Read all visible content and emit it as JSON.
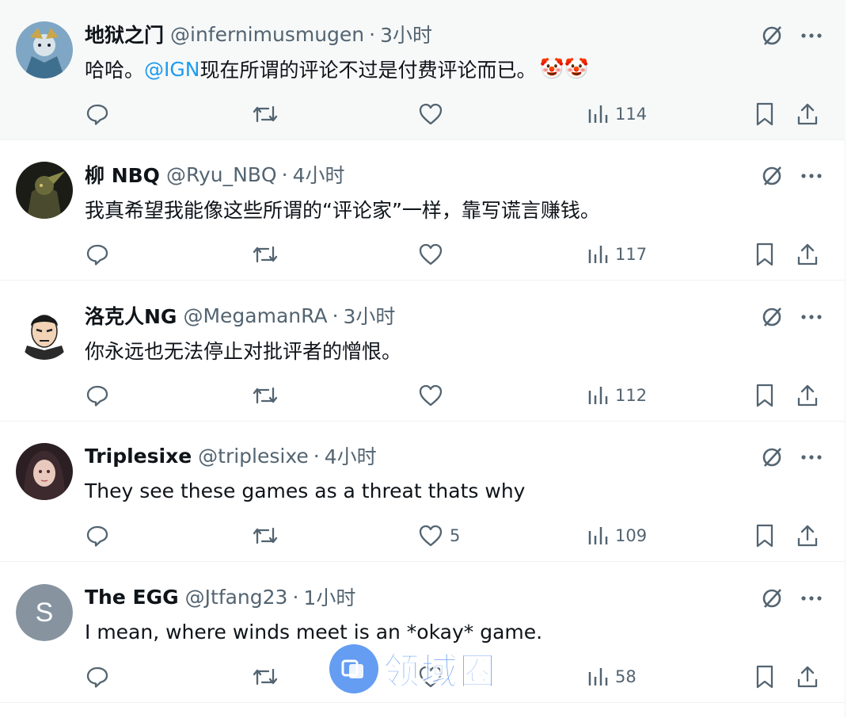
{
  "colors": {
    "link": "#1d9bf0",
    "secondary_text": "#536471",
    "primary_text": "#0f1419",
    "highlight_bg": "#f7f9f9",
    "watermark": "#4a8cf0"
  },
  "tweets": [
    {
      "name": "地狱之门",
      "handle": "@infernimusmugen",
      "sep": "·",
      "time": "3小时",
      "text_before": "哈哈。",
      "mention": "@IGN",
      "text_after": "现在所谓的评论不过是付费评论而已。",
      "emoji": "🤡🤡",
      "likes": "",
      "views": "114",
      "avatar": "anime-character-avatar"
    },
    {
      "name": "柳 NBQ",
      "handle": "@Ryu_NBQ",
      "sep": "·",
      "time": "4小时",
      "text": "我真希望我能像这些所谓的“评论家”一样，靠写谎言赚钱。",
      "likes": "",
      "views": "117",
      "avatar": "dark-armored-character-avatar"
    },
    {
      "name": "洛克人NG",
      "handle": "@MegamanRA",
      "sep": "·",
      "time": "3小时",
      "text": "你永远也无法停止对批评者的憎恨。",
      "likes": "",
      "views": "112",
      "avatar": "cartoon-man-avatar"
    },
    {
      "name": "Triplesixe",
      "handle": "@triplesixe",
      "sep": "·",
      "time": "4小时",
      "text": "They see these games as a threat thats why",
      "likes": "5",
      "views": "109",
      "avatar": "anime-girl-avatar"
    },
    {
      "name": "The EGG",
      "handle": "@Jtfang23",
      "sep": "·",
      "time": "1小时",
      "text": "I mean, where winds meet is an *okay* game.",
      "likes": "",
      "views": "58",
      "avatar_letter": "S"
    }
  ],
  "watermark": {
    "text": "领域圈"
  }
}
